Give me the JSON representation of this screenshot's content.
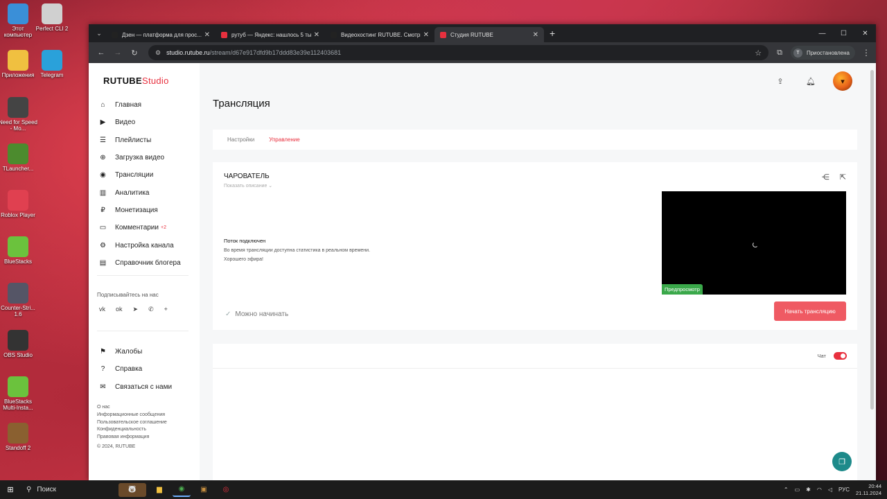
{
  "desktop": {
    "icons": [
      {
        "label": "Этот компьютер",
        "color": "#3a8fd8"
      },
      {
        "label": "Perfect CLI 2",
        "color": "#d0d0d0"
      },
      {
        "label": "Приложения",
        "color": "#f0c040"
      },
      {
        "label": "Telegram",
        "color": "#2aa1da"
      },
      {
        "label": "Need for Speed - Mo...",
        "color": "#444"
      },
      {
        "label": "TLauncher...",
        "color": "#4c8b2e"
      },
      {
        "label": "Roblox Player",
        "color": "#e04050"
      },
      {
        "label": "BlueStacks",
        "color": "#6bc23d"
      },
      {
        "label": "Counter-Stri... 1.6",
        "color": "#556"
      },
      {
        "label": "OBS Studio",
        "color": "#333"
      },
      {
        "label": "BlueStacks Multi-Insta...",
        "color": "#6bc23d"
      },
      {
        "label": "Standoff 2",
        "color": "#8a6030"
      }
    ]
  },
  "browser": {
    "tabs": [
      {
        "title": "Дзен — платформа для прос...",
        "color": "#222",
        "active": false
      },
      {
        "title": "рутуб — Яндекс: нашлось 5 ты...",
        "color": "#e8303e",
        "active": false
      },
      {
        "title": "Видеохостинг RUTUBE. Смотри...",
        "color": "#222",
        "active": false
      },
      {
        "title": "Студия RUTUBE",
        "color": "#e8303e",
        "active": true
      }
    ],
    "url_host": "studio.rutube.ru",
    "url_path": "/stream/d67e917dfd9b17ddd83e39e112403681",
    "profile_initial": "T",
    "profile_label": "Приостановлена"
  },
  "sidebar": {
    "logo_main": "RUTUBE",
    "logo_suffix": "Studio",
    "items": [
      {
        "label": "Главная",
        "icon": "home-icon",
        "glyph": "⌂"
      },
      {
        "label": "Видео",
        "icon": "video-icon",
        "glyph": "▶"
      },
      {
        "label": "Плейлисты",
        "icon": "playlist-icon",
        "glyph": "☰"
      },
      {
        "label": "Загрузка видео",
        "icon": "upload-icon",
        "glyph": "⊕"
      },
      {
        "label": "Трансляции",
        "icon": "broadcast-icon",
        "glyph": "◉"
      },
      {
        "label": "Аналитика",
        "icon": "analytics-icon",
        "glyph": "▥"
      },
      {
        "label": "Монетизация",
        "icon": "monetization-icon",
        "glyph": "₽"
      },
      {
        "label": "Комментарии",
        "icon": "comments-icon",
        "glyph": "▭",
        "badge": "+2"
      },
      {
        "label": "Настройка канала",
        "icon": "settings-icon",
        "glyph": "⚙"
      },
      {
        "label": "Справочник блогера",
        "icon": "handbook-icon",
        "glyph": "▤"
      }
    ],
    "follow_label": "Подписывайтесь на нас",
    "socials": [
      "vk",
      "ok",
      "tg",
      "vb",
      "+"
    ],
    "secondary_items": [
      {
        "label": "Жалобы",
        "icon": "flag-icon",
        "glyph": "⚑"
      },
      {
        "label": "Справка",
        "icon": "help-icon",
        "glyph": "?"
      },
      {
        "label": "Связаться с нами",
        "icon": "mail-icon",
        "glyph": "✉"
      }
    ],
    "footer_links": [
      "О нас",
      "Информационные сообщения",
      "Пользовательское соглашение",
      "Конфиденциальность",
      "Правовая информация"
    ],
    "copyright": "© 2024, RUTUBE"
  },
  "main": {
    "title": "Трансляция",
    "tabs": [
      {
        "label": "Настройки",
        "active": false
      },
      {
        "label": "Управление",
        "active": true
      }
    ],
    "stream": {
      "name": "ЧАРОВАТЕЛЬ",
      "show_description": "Показать описание",
      "status_title": "Поток подключен",
      "status_line1": "Во время трансляции доступна статистика в реальном времени.",
      "status_line2": "Хорошего эфира!",
      "ready_label": "Можно начинать",
      "preview_badge": "Предпросмотр",
      "start_button": "Начать трансляцию"
    },
    "chat_label": "Чат",
    "chat_enabled": true
  },
  "taskbar": {
    "search_label": "Поиск",
    "lang": "РУС",
    "time": "20:44",
    "date": "21.11.2024"
  }
}
